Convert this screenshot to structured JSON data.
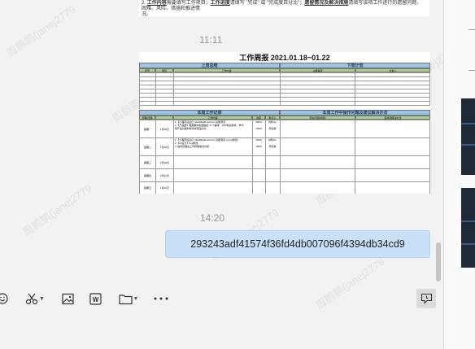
{
  "messages": {
    "doc_top": {
      "line1_prefix": "2.",
      "line1_bold1": "工作内容",
      "line1_text1": "需要填写工作项目；",
      "line1_bold2": "工作进度",
      "line1_text2": "请填写 \"完成\" 或 \"完成度百分比\"；",
      "line1_bold3": "遗留情况及解决措施",
      "line1_text3": "请填写该项工作进行的遗留问题、困难、风险、措施和推进情",
      "line2": "况。"
    },
    "time_1": "11:11",
    "time_2": "14:20",
    "text_message": "293243adf41574f36fd4db007096f4394db34cd9"
  },
  "report": {
    "title": "工作周报 2021.01.18~01.22",
    "last_week_section": "上周总结",
    "next_week_section": "下周计划",
    "last_week_cols": [
      "序号",
      "项目",
      "工作内容"
    ],
    "next_week_cols": [
      "主要事项",
      "负责人"
    ],
    "this_week_section": "本周工作记录",
    "issues_section": "本周工作中操作问题及建议解决办法",
    "this_week_cols": [
      "周期/日期",
      "",
      "工作内容",
      "进度",
      "参与人"
    ],
    "issues_cols": [
      "存在问题(简称)",
      "需协调解决办法"
    ],
    "days": [
      {
        "name": "星期一",
        "date": "1月18日",
        "tasks": [
          "1.【小程序/后台】site2MaxB-doc/run 功能测试",
          "2.【产品部】根据敏中集团提的 17个需求：APP和兑换商、参与",
          "现产品对其时候处商库品对比"
        ],
        "progress": [
          "100%",
          "100%"
        ],
        "person": [
          "刘利/LL",
          "周德勇"
        ]
      },
      {
        "name": "星期二",
        "date": "1月19日",
        "tasks": [
          "1.【小程序/后台】site2MaxB-doc/run 功能测试 (+bug修改)",
          "2.【UI设计】bug修改",
          "3. 操作员做出工作周报格式分析"
        ],
        "progress": [
          "100%",
          "100%"
        ],
        "person": [
          "刘利/LL",
          "周德勇"
        ]
      },
      {
        "name": "星期三",
        "date": "1月20日",
        "tasks": [],
        "progress": [],
        "person": []
      },
      {
        "name": "星期四",
        "date": "1月21日",
        "tasks": [],
        "progress": [],
        "person": []
      },
      {
        "name": "星期五",
        "date": "1月22日",
        "tasks": [],
        "progress": [],
        "person": []
      }
    ]
  },
  "watermark": "周鹏鹏(janej2779",
  "toolbar": {
    "icons": [
      "emoji-icon",
      "scissors-icon",
      "image-icon",
      "word-doc-icon",
      "folder-icon",
      "more-icon"
    ],
    "history_icon": "chat-history-icon"
  },
  "colors": {
    "bubble": "#c8e0f8",
    "section_header": "#9dc3e6",
    "column_header": "#a9d08e"
  }
}
